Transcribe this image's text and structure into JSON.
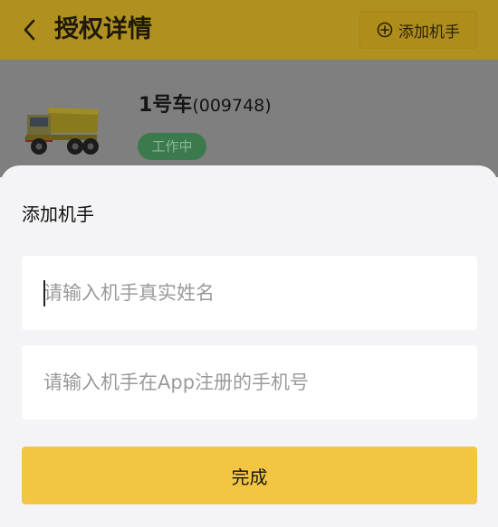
{
  "header": {
    "title": "授权详情",
    "add_button_label": "添加机手",
    "back_icon": "chevron-left-icon",
    "add_icon": "plus-circle-icon"
  },
  "vehicle": {
    "name": "1号车",
    "code": "(009748)",
    "status": "工作中",
    "image": "dump-truck-image"
  },
  "sheet": {
    "title": "添加机手",
    "name_field": {
      "value": "",
      "placeholder": "请输入机手真实姓名"
    },
    "phone_field": {
      "value": "",
      "placeholder": "请输入机手在App注册的手机号"
    },
    "done_label": "完成"
  },
  "colors": {
    "accent": "#f2c542",
    "header_dimmed": "#b0901f",
    "status_green": "#3b7a4c",
    "sheet_background": "#f4f4f6"
  }
}
